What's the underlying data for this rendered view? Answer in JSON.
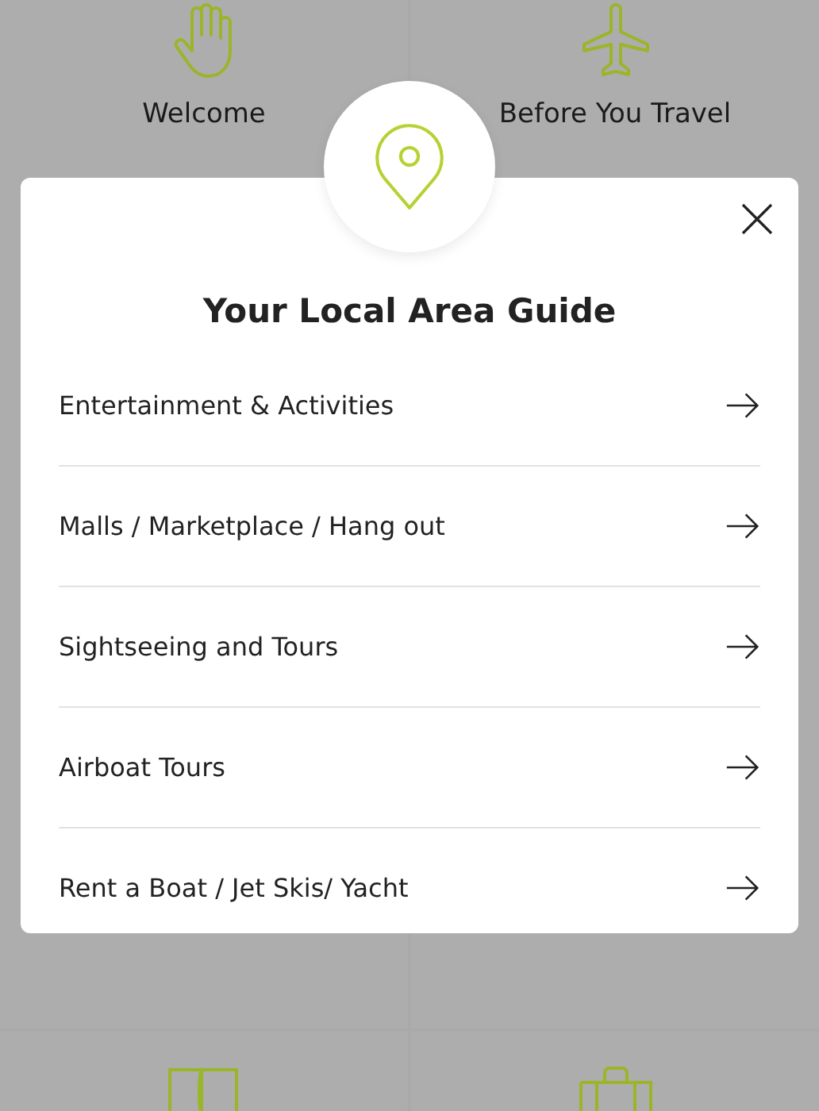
{
  "tiles_top": [
    {
      "label": "Welcome",
      "kind": "hand"
    },
    {
      "label": "Before You Travel",
      "kind": "plane"
    }
  ],
  "tiles_bottom": [
    {
      "kind": "book"
    },
    {
      "kind": "luggage"
    }
  ],
  "modal": {
    "title": "Your Local Area Guide",
    "items": [
      {
        "label": "Entertainment & Activities"
      },
      {
        "label": "Malls / Marketplace / Hang out"
      },
      {
        "label": "Sightseeing and Tours"
      },
      {
        "label": "Airboat Tours"
      },
      {
        "label": "Rent a Boat / Jet Skis/ Yacht"
      }
    ]
  }
}
